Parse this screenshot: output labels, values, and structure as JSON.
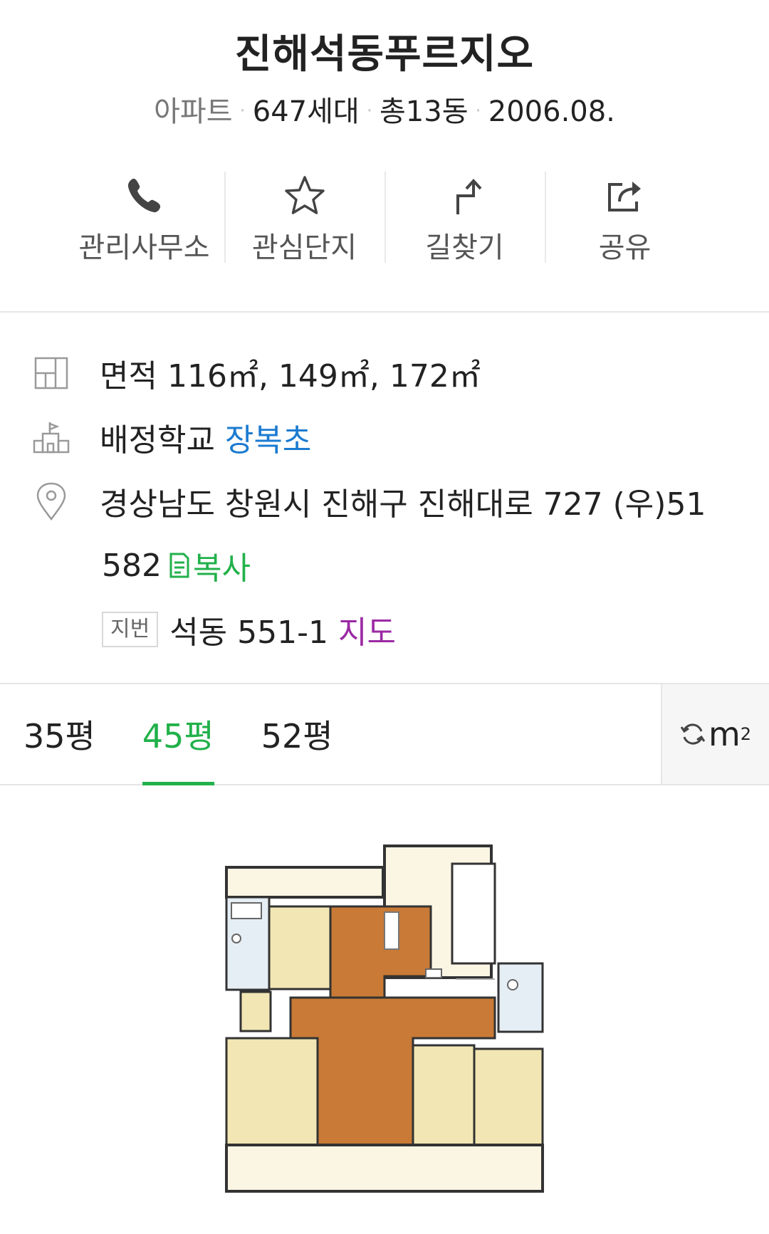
{
  "header": {
    "title": "진해석동푸르지오",
    "type": "아파트",
    "households": "647세대",
    "buildings": "총13동",
    "date": "2006.08.",
    "separator": "·"
  },
  "actions": [
    {
      "label": "관리사무소",
      "icon": "phone-icon"
    },
    {
      "label": "관심단지",
      "icon": "star-icon"
    },
    {
      "label": "길찾기",
      "icon": "directions-icon"
    },
    {
      "label": "공유",
      "icon": "share-icon"
    }
  ],
  "info": {
    "area_label": "면적",
    "area_values": "116㎡, 149㎡, 172㎡",
    "school_label": "배정학교",
    "school_name": "장복초",
    "address_line1": "경상남도 창원시 진해구 진해대로 727 (우)51",
    "address_line2": "582",
    "copy_label": "복사",
    "lot_badge": "지번",
    "lot_address": "석동 551-1",
    "map_link": "지도"
  },
  "tabs": {
    "items": [
      "35평",
      "45평",
      "52평"
    ],
    "active_index": 1,
    "unit_toggle": "m",
    "unit_sup": "2"
  },
  "colors": {
    "accent_green": "#21b14a",
    "link_blue": "#1b7bd0",
    "link_purple": "#9b2aa3",
    "floor_wood": "#c87a36",
    "room_beige": "#f2e7b4"
  }
}
